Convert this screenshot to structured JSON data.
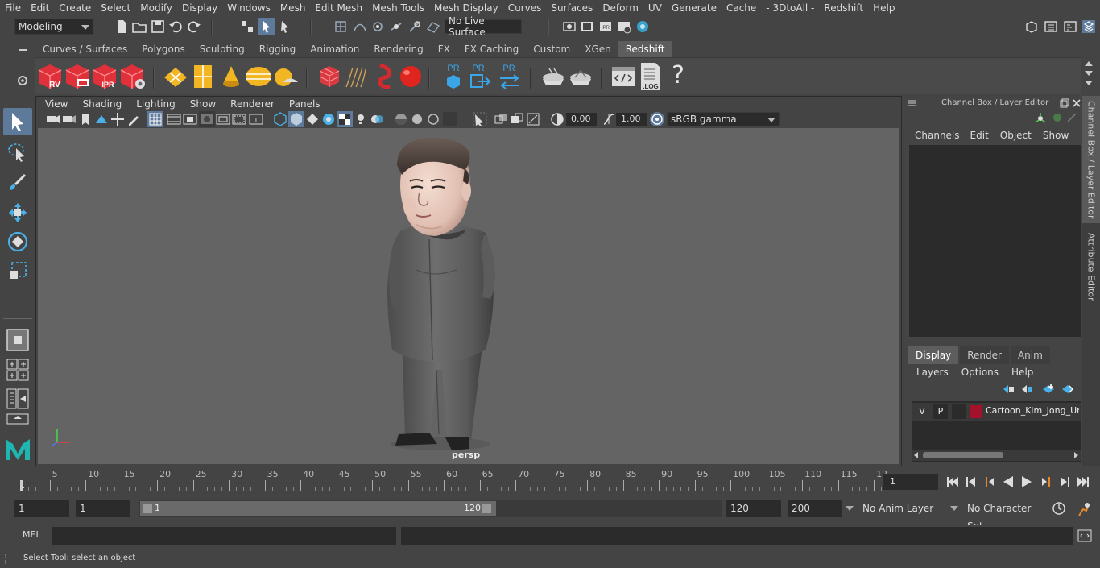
{
  "menubar": {
    "items": [
      "File",
      "Edit",
      "Create",
      "Select",
      "Modify",
      "Display",
      "Windows",
      "Mesh",
      "Edit Mesh",
      "Mesh Tools",
      "Mesh Display",
      "Curves",
      "Surfaces",
      "Deform",
      "UV",
      "Generate",
      "Cache",
      "- 3DtoAll -",
      "Redshift",
      "Help"
    ]
  },
  "statusline": {
    "mode_selector": "Modeling",
    "live_surface": "No Live Surface"
  },
  "shelf": {
    "tabs": [
      "Curves / Surfaces",
      "Polygons",
      "Sculpting",
      "Rigging",
      "Animation",
      "Rendering",
      "FX",
      "FX Caching",
      "Custom",
      "XGen",
      "Redshift"
    ],
    "active_tab": "Redshift",
    "icon_labels": {
      "rv": "RV",
      "ipr": "IPR",
      "pr": "PR",
      "log": ".LOG",
      "help": "?"
    }
  },
  "viewport": {
    "menu": [
      "View",
      "Shading",
      "Lighting",
      "Show",
      "Renderer",
      "Panels"
    ],
    "exposure": "0.00",
    "gamma": "1.00",
    "color_space": "sRGB gamma",
    "camera_label": "persp"
  },
  "channel_box": {
    "title": "Channel Box / Layer Editor",
    "menu": [
      "Channels",
      "Edit",
      "Object",
      "Show"
    ]
  },
  "layer_editor": {
    "tabs": [
      "Display",
      "Render",
      "Anim"
    ],
    "active_tab": "Display",
    "menu": [
      "Layers",
      "Options",
      "Help"
    ],
    "layers": [
      {
        "v": "V",
        "p": "P",
        "color": "#a3122a",
        "name": "Cartoon_Kim_Jong_Un"
      }
    ]
  },
  "side_tabs": [
    "Channel Box / Layer Editor",
    "Attribute Editor"
  ],
  "timeslider": {
    "labels": [
      "5",
      "10",
      "15",
      "20",
      "25",
      "30",
      "35",
      "40",
      "45",
      "50",
      "55",
      "60",
      "65",
      "70",
      "75",
      "80",
      "85",
      "90",
      "95",
      "100",
      "105",
      "110",
      "115",
      "12"
    ],
    "start_label": "1",
    "current_frame": "1"
  },
  "range": {
    "start": "1",
    "playback_start": "1",
    "slider_start": "1",
    "slider_end": "120",
    "playback_end": "120",
    "end": "200",
    "anim_layer": "No Anim Layer",
    "character_set": "No Character Set"
  },
  "cmdline": {
    "label": "MEL"
  },
  "helpline": {
    "text": "Select Tool: select an object"
  }
}
